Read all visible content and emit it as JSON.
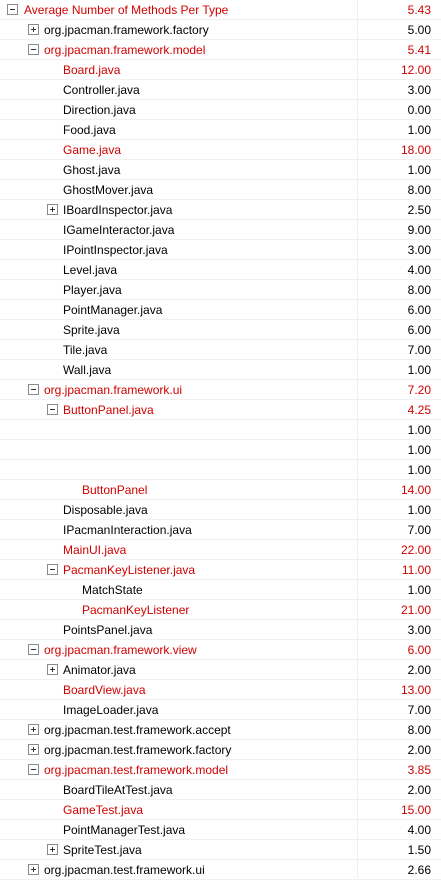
{
  "colors": {
    "highlight": "#d00000",
    "normal": "#000000"
  },
  "rows": [
    {
      "label": "Average Number of Methods Per Type",
      "value": "5.43",
      "red": true,
      "level": 0,
      "toggle": "minus"
    },
    {
      "label": "org.jpacman.framework.factory",
      "value": "5.00",
      "red": false,
      "level": 1,
      "toggle": "plus"
    },
    {
      "label": "org.jpacman.framework.model",
      "value": "5.41",
      "red": true,
      "level": 1,
      "toggle": "minus"
    },
    {
      "label": "Board.java",
      "value": "12.00",
      "red": true,
      "level": 2,
      "toggle": null
    },
    {
      "label": "Controller.java",
      "value": "3.00",
      "red": false,
      "level": 2,
      "toggle": null
    },
    {
      "label": "Direction.java",
      "value": "0.00",
      "red": false,
      "level": 2,
      "toggle": null
    },
    {
      "label": "Food.java",
      "value": "1.00",
      "red": false,
      "level": 2,
      "toggle": null
    },
    {
      "label": "Game.java",
      "value": "18.00",
      "red": true,
      "level": 2,
      "toggle": null
    },
    {
      "label": "Ghost.java",
      "value": "1.00",
      "red": false,
      "level": 2,
      "toggle": null
    },
    {
      "label": "GhostMover.java",
      "value": "8.00",
      "red": false,
      "level": 2,
      "toggle": null
    },
    {
      "label": "IBoardInspector.java",
      "value": "2.50",
      "red": false,
      "level": 2,
      "toggle": "plus"
    },
    {
      "label": "IGameInteractor.java",
      "value": "9.00",
      "red": false,
      "level": 2,
      "toggle": null
    },
    {
      "label": "IPointInspector.java",
      "value": "3.00",
      "red": false,
      "level": 2,
      "toggle": null
    },
    {
      "label": "Level.java",
      "value": "4.00",
      "red": false,
      "level": 2,
      "toggle": null
    },
    {
      "label": "Player.java",
      "value": "8.00",
      "red": false,
      "level": 2,
      "toggle": null
    },
    {
      "label": "PointManager.java",
      "value": "6.00",
      "red": false,
      "level": 2,
      "toggle": null
    },
    {
      "label": "Sprite.java",
      "value": "6.00",
      "red": false,
      "level": 2,
      "toggle": null
    },
    {
      "label": "Tile.java",
      "value": "7.00",
      "red": false,
      "level": 2,
      "toggle": null
    },
    {
      "label": "Wall.java",
      "value": "1.00",
      "red": false,
      "level": 2,
      "toggle": null
    },
    {
      "label": "org.jpacman.framework.ui",
      "value": "7.20",
      "red": true,
      "level": 1,
      "toggle": "minus"
    },
    {
      "label": "ButtonPanel.java",
      "value": "4.25",
      "red": true,
      "level": 2,
      "toggle": "minus"
    },
    {
      "label": "",
      "value": "1.00",
      "red": false,
      "level": 3,
      "toggle": null
    },
    {
      "label": "",
      "value": "1.00",
      "red": false,
      "level": 3,
      "toggle": null
    },
    {
      "label": "",
      "value": "1.00",
      "red": false,
      "level": 3,
      "toggle": null
    },
    {
      "label": "ButtonPanel",
      "value": "14.00",
      "red": true,
      "level": 3,
      "toggle": null
    },
    {
      "label": "Disposable.java",
      "value": "1.00",
      "red": false,
      "level": 2,
      "toggle": null
    },
    {
      "label": "IPacmanInteraction.java",
      "value": "7.00",
      "red": false,
      "level": 2,
      "toggle": null
    },
    {
      "label": "MainUI.java",
      "value": "22.00",
      "red": true,
      "level": 2,
      "toggle": null
    },
    {
      "label": "PacmanKeyListener.java",
      "value": "11.00",
      "red": true,
      "level": 2,
      "toggle": "minus"
    },
    {
      "label": "MatchState",
      "value": "1.00",
      "red": false,
      "level": 3,
      "toggle": null
    },
    {
      "label": "PacmanKeyListener",
      "value": "21.00",
      "red": true,
      "level": 3,
      "toggle": null
    },
    {
      "label": "PointsPanel.java",
      "value": "3.00",
      "red": false,
      "level": 2,
      "toggle": null
    },
    {
      "label": "org.jpacman.framework.view",
      "value": "6.00",
      "red": true,
      "level": 1,
      "toggle": "minus"
    },
    {
      "label": "Animator.java",
      "value": "2.00",
      "red": false,
      "level": 2,
      "toggle": "plus"
    },
    {
      "label": "BoardView.java",
      "value": "13.00",
      "red": true,
      "level": 2,
      "toggle": null
    },
    {
      "label": "ImageLoader.java",
      "value": "7.00",
      "red": false,
      "level": 2,
      "toggle": null
    },
    {
      "label": "org.jpacman.test.framework.accept",
      "value": "8.00",
      "red": false,
      "level": 1,
      "toggle": "plus"
    },
    {
      "label": "org.jpacman.test.framework.factory",
      "value": "2.00",
      "red": false,
      "level": 1,
      "toggle": "plus"
    },
    {
      "label": "org.jpacman.test.framework.model",
      "value": "3.85",
      "red": true,
      "level": 1,
      "toggle": "minus"
    },
    {
      "label": "BoardTileAtTest.java",
      "value": "2.00",
      "red": false,
      "level": 2,
      "toggle": null
    },
    {
      "label": "GameTest.java",
      "value": "15.00",
      "red": true,
      "level": 2,
      "toggle": null
    },
    {
      "label": "PointManagerTest.java",
      "value": "4.00",
      "red": false,
      "level": 2,
      "toggle": null
    },
    {
      "label": "SpriteTest.java",
      "value": "1.50",
      "red": false,
      "level": 2,
      "toggle": "plus"
    },
    {
      "label": "org.jpacman.test.framework.ui",
      "value": "2.66",
      "red": false,
      "level": 1,
      "toggle": "plus"
    }
  ]
}
